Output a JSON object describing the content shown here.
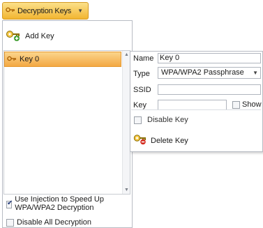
{
  "toolbar": {
    "tab_label": "Decryption Keys",
    "tab_icon": "key-icon"
  },
  "actions": {
    "add_key": "Add Key"
  },
  "keys_list": {
    "items": [
      {
        "label": "Key 0",
        "selected": true
      }
    ]
  },
  "options": {
    "use_injection_label": "Use Injection to Speed Up WPA/WPA2  Decryption",
    "use_injection_checked": true,
    "disable_all_label": "Disable All Decryption",
    "disable_all_checked": false
  },
  "properties": {
    "name_label": "Name",
    "name_value": "Key 0",
    "type_label": "Type",
    "type_value": "WPA/WPA2 Passphrase",
    "ssid_label": "SSID",
    "ssid_value": "",
    "key_label": "Key",
    "key_value": "",
    "show_label": "Show",
    "disable_key_label": "Disable Key",
    "delete_key_label": "Delete Key"
  },
  "colors": {
    "accent": "#f2b531",
    "selection": "#f3a843",
    "border": "#b8bcc4"
  }
}
